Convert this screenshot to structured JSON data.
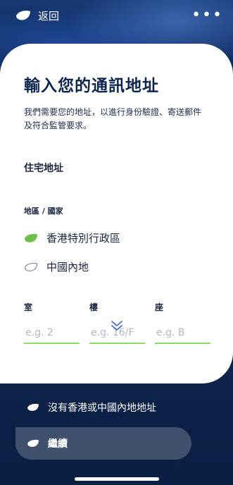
{
  "header": {
    "back_label": "返回",
    "more_icon": "more-dots-icon"
  },
  "form": {
    "title": "輸入您的通訊地址",
    "subtitle": "我們需要您的地址，以進行身份驗證、寄送郵件及符合監管要求。",
    "section_title": "住宅地址",
    "region_label": "地區 / 國家",
    "regions": [
      {
        "label": "香港特別行政區",
        "selected": true
      },
      {
        "label": "中國內地",
        "selected": false
      }
    ],
    "fields": [
      {
        "label": "室",
        "placeholder": "e.g. 2",
        "value": ""
      },
      {
        "label": "樓",
        "placeholder": "e.g. 16/F",
        "value": ""
      },
      {
        "label": "座",
        "placeholder": "e.g. B",
        "value": ""
      }
    ],
    "scroll_icon": "double-chevron-down-icon"
  },
  "footer": {
    "alt_label": "沒有香港或中國內地地址",
    "continue_label": "繼續"
  },
  "colors": {
    "accent_green": "#6cc04a",
    "navy": "#0d2146",
    "title_navy": "#0c2652"
  }
}
